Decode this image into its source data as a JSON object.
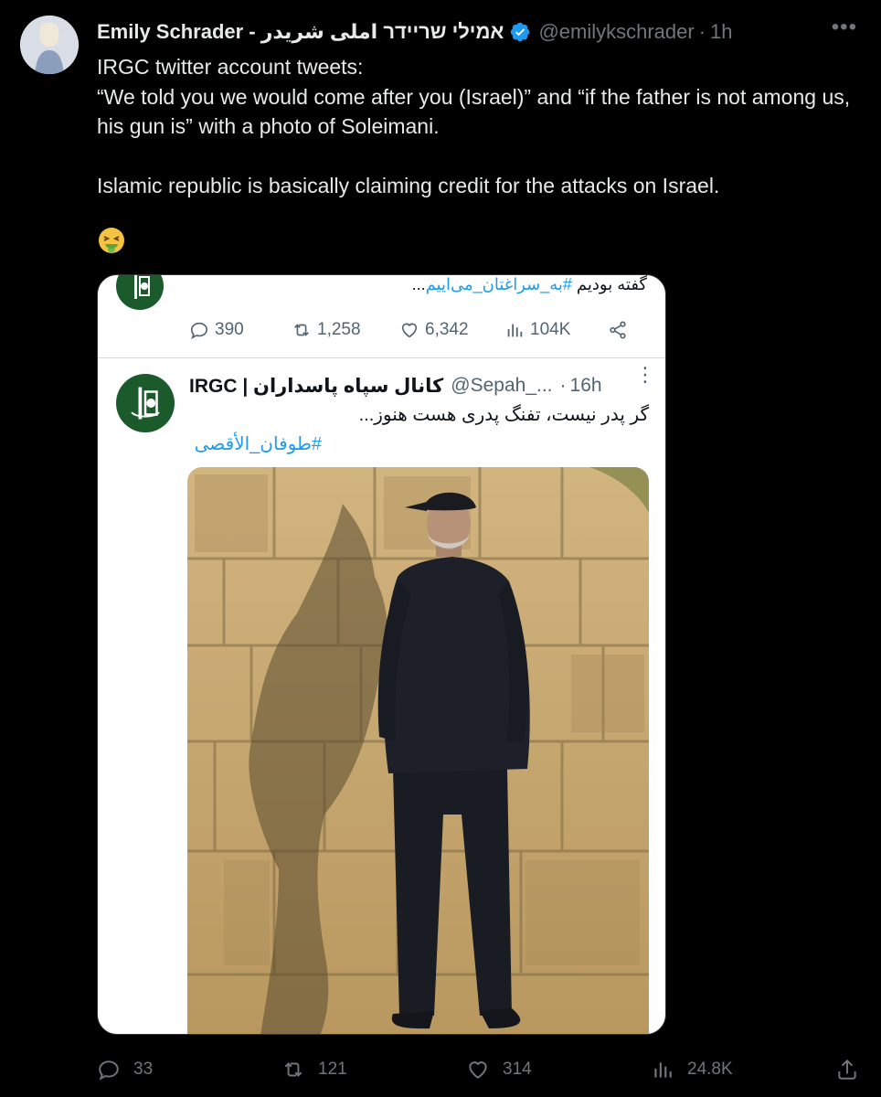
{
  "author": {
    "display_name": "Emily Schrader - אמילי שריידר املی شریدر",
    "verified": true,
    "handle": "@emilykschrader",
    "separator": "·",
    "time": "1h"
  },
  "tweet": {
    "lines": [
      "IRGC twitter account tweets:",
      "“We told you we would come after you (Israel)” and “if the father is not among us, his gun is” with a photo of Soleimani.",
      "",
      "Islamic republic is basically claiming credit for the attacks on Israel.",
      "",
      "🤮"
    ]
  },
  "embed": {
    "top_text_prefix": "گفته بودیم",
    "top_hashtag": "#به_سراغتان_می‌اییم",
    "top_text_suffix": "...",
    "actions": {
      "replies": "390",
      "reposts": "1,258",
      "likes": "6,342",
      "views": "104K"
    },
    "quoted": {
      "name": "IRGC | کانال سپاه پاسداران",
      "handle": "@Sepah_...",
      "separator": "·",
      "time": "16h",
      "text": "گر پدر نیست، تفنگ پدری هست هنوز...",
      "hashtag": "#طوفان_الأقصى"
    }
  },
  "actions": {
    "replies": "33",
    "reposts": "121",
    "likes": "314",
    "views": "24.8K"
  },
  "colors": {
    "background": "#000000",
    "text": "#e7e9ea",
    "muted": "#71767b",
    "verified": "#1d9bf0",
    "link": "#1d9bf0",
    "irgc_green": "#1b5a2a"
  },
  "icons": [
    "more-icon",
    "verified-icon",
    "reply-icon",
    "repost-icon",
    "like-icon",
    "views-icon",
    "share-icon"
  ]
}
